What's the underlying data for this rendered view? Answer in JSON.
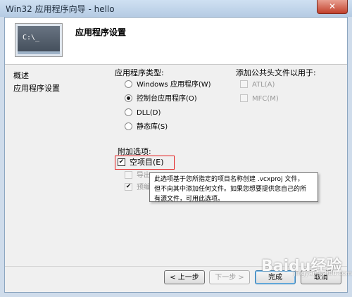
{
  "window": {
    "title": "Win32 应用程序向导 - hello",
    "close_glyph": "✕"
  },
  "header": {
    "icon_text": "C:\\_",
    "title": "应用程序设置"
  },
  "nav": {
    "items": [
      "概述",
      "应用程序设置"
    ]
  },
  "app_type": {
    "label": "应用程序类型:",
    "options": [
      "Windows 应用程序(W)",
      "控制台应用程序(O)",
      "DLL(D)",
      "静态库(S)"
    ],
    "selected": "控制台应用程序(O)"
  },
  "common_headers": {
    "label": "添加公共头文件以用于:",
    "options": [
      "ATL(A)",
      "MFC(M)"
    ]
  },
  "additional": {
    "label": "附加选项:",
    "empty_project": "空项目(E)",
    "export_symbols": "导出",
    "precompiled_header": "预编",
    "check_glyph": "✔"
  },
  "tooltip": {
    "line1": "此选项基于您所指定的项目名称创建 .vcxproj 文件，",
    "line2": "但不向其中添加任何文件。如果您想要提供您自己的所",
    "line3": "有源文件，可用此选项。"
  },
  "buttons": {
    "prev": "< 上一步",
    "next": "下一步 >",
    "finish": "完成",
    "cancel": "取消"
  },
  "watermark": {
    "text": "Baidu经验",
    "sub": "jingyan.baidu.com"
  }
}
